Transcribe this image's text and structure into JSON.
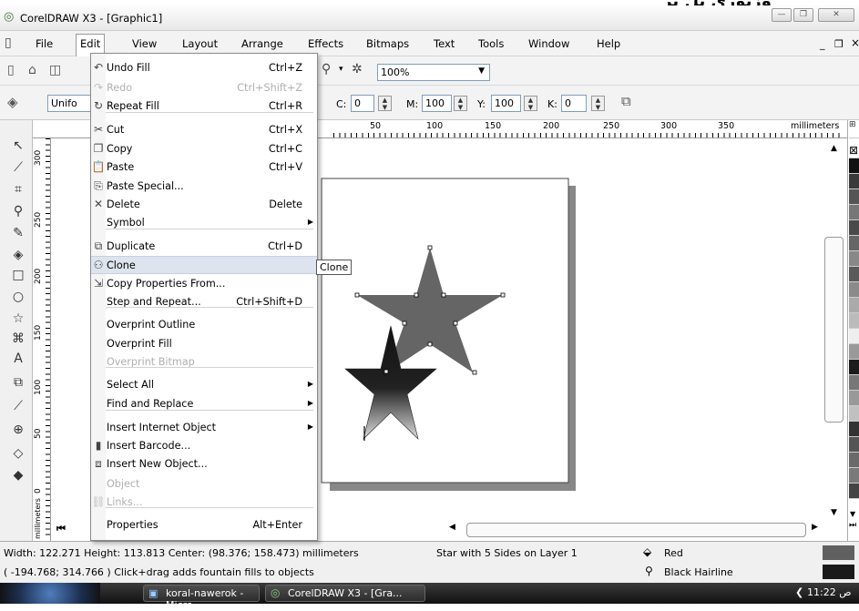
{
  "overlay_text": "وزبوري يل بر",
  "window": {
    "title": "CorelDRAW X3 - [Graphic1]",
    "minimize": "—",
    "restore": "❐",
    "close": "✕",
    "doc_minimize": "_",
    "doc_restore": "❐",
    "doc_close": "×"
  },
  "menubar": [
    "File",
    "Edit",
    "View",
    "Layout",
    "Arrange",
    "Effects",
    "Bitmaps",
    "Text",
    "Tools",
    "Window",
    "Help"
  ],
  "toolbar": {
    "zoom": "100%"
  },
  "property_bar": {
    "fill_type": "Unifo",
    "c_label": "C:",
    "c_value": "0",
    "m_label": "M:",
    "m_value": "100",
    "y_label": "Y:",
    "y_value": "100",
    "k_label": "K:",
    "k_value": "0"
  },
  "ruler": {
    "h_ticks": [
      "50",
      "100",
      "150",
      "200",
      "250",
      "300",
      "350"
    ],
    "h_unit": "millimeters",
    "v_ticks": [
      "300",
      "250",
      "200",
      "150",
      "100",
      "50",
      "0"
    ],
    "v_unit": "millimeters"
  },
  "edit_menu": [
    {
      "label": "Undo Fill",
      "shortcut": "Ctrl+Z",
      "icon": "undo-icon",
      "disabled": false
    },
    {
      "label": "Redo",
      "shortcut": "Ctrl+Shift+Z",
      "icon": "redo-icon",
      "disabled": true
    },
    {
      "label": "Repeat Fill",
      "shortcut": "Ctrl+R",
      "icon": "repeat-icon",
      "disabled": false
    },
    {
      "label": "Cut",
      "shortcut": "Ctrl+X",
      "icon": "cut-icon",
      "disabled": false
    },
    {
      "label": "Copy",
      "shortcut": "Ctrl+C",
      "icon": "copy-icon",
      "disabled": false
    },
    {
      "label": "Paste",
      "shortcut": "Ctrl+V",
      "icon": "paste-icon",
      "disabled": false
    },
    {
      "label": "Paste Special...",
      "shortcut": "",
      "icon": "paste-special-icon",
      "disabled": false
    },
    {
      "label": "Delete",
      "shortcut": "Delete",
      "icon": "delete-icon",
      "disabled": false
    },
    {
      "label": "Symbol",
      "shortcut": "",
      "icon": "",
      "disabled": false,
      "submenu": true
    },
    {
      "label": "Duplicate",
      "shortcut": "Ctrl+D",
      "icon": "duplicate-icon",
      "disabled": false
    },
    {
      "label": "Clone",
      "shortcut": "",
      "icon": "clone-icon",
      "disabled": false,
      "highlighted": true
    },
    {
      "label": "Copy Properties From...",
      "shortcut": "",
      "icon": "copy-properties-icon",
      "disabled": false
    },
    {
      "label": "Step and Repeat...",
      "shortcut": "Ctrl+Shift+D",
      "icon": "",
      "disabled": false
    },
    {
      "label": "Overprint Outline",
      "shortcut": "",
      "icon": "",
      "disabled": false
    },
    {
      "label": "Overprint Fill",
      "shortcut": "",
      "icon": "",
      "disabled": false
    },
    {
      "label": "Overprint Bitmap",
      "shortcut": "",
      "icon": "",
      "disabled": true
    },
    {
      "label": "Select All",
      "shortcut": "",
      "icon": "",
      "disabled": false,
      "submenu": true
    },
    {
      "label": "Find and Replace",
      "shortcut": "",
      "icon": "",
      "disabled": false,
      "submenu": true
    },
    {
      "label": "Insert Internet Object",
      "shortcut": "",
      "icon": "",
      "disabled": false,
      "submenu": true
    },
    {
      "label": "Insert Barcode...",
      "shortcut": "",
      "icon": "barcode-icon",
      "disabled": false
    },
    {
      "label": "Insert New Object...",
      "shortcut": "",
      "icon": "insert-object-icon",
      "disabled": false
    },
    {
      "label": "Object",
      "shortcut": "",
      "icon": "",
      "disabled": true
    },
    {
      "label": "Links...",
      "shortcut": "",
      "icon": "ole-links-icon",
      "disabled": true
    },
    {
      "label": "Properties",
      "shortcut": "Alt+Enter",
      "icon": "",
      "disabled": false
    }
  ],
  "tooltip": "Clone",
  "status": {
    "line1": "Width: 122.271 Height: 113.813 Center: (98.376; 158.473) millimeters",
    "object": "Star with 5 Sides on Layer 1",
    "fill": "Red",
    "line2": "( -194.768; 314.766 )  Click+drag adds fountain fills to objects",
    "outline": "Black  Hairline",
    "fill_color": "#606060",
    "outline_color": "#1a1a1a"
  },
  "taskbar": {
    "task1": "koral-nawerok - Micro...",
    "task2": "CorelDRAW X3 - [Gra...",
    "clock": "11:22 ص"
  },
  "colors": {
    "star_large": "#656565",
    "star_small_top": "#111111",
    "star_small_bottom": "#d8d8d8"
  }
}
